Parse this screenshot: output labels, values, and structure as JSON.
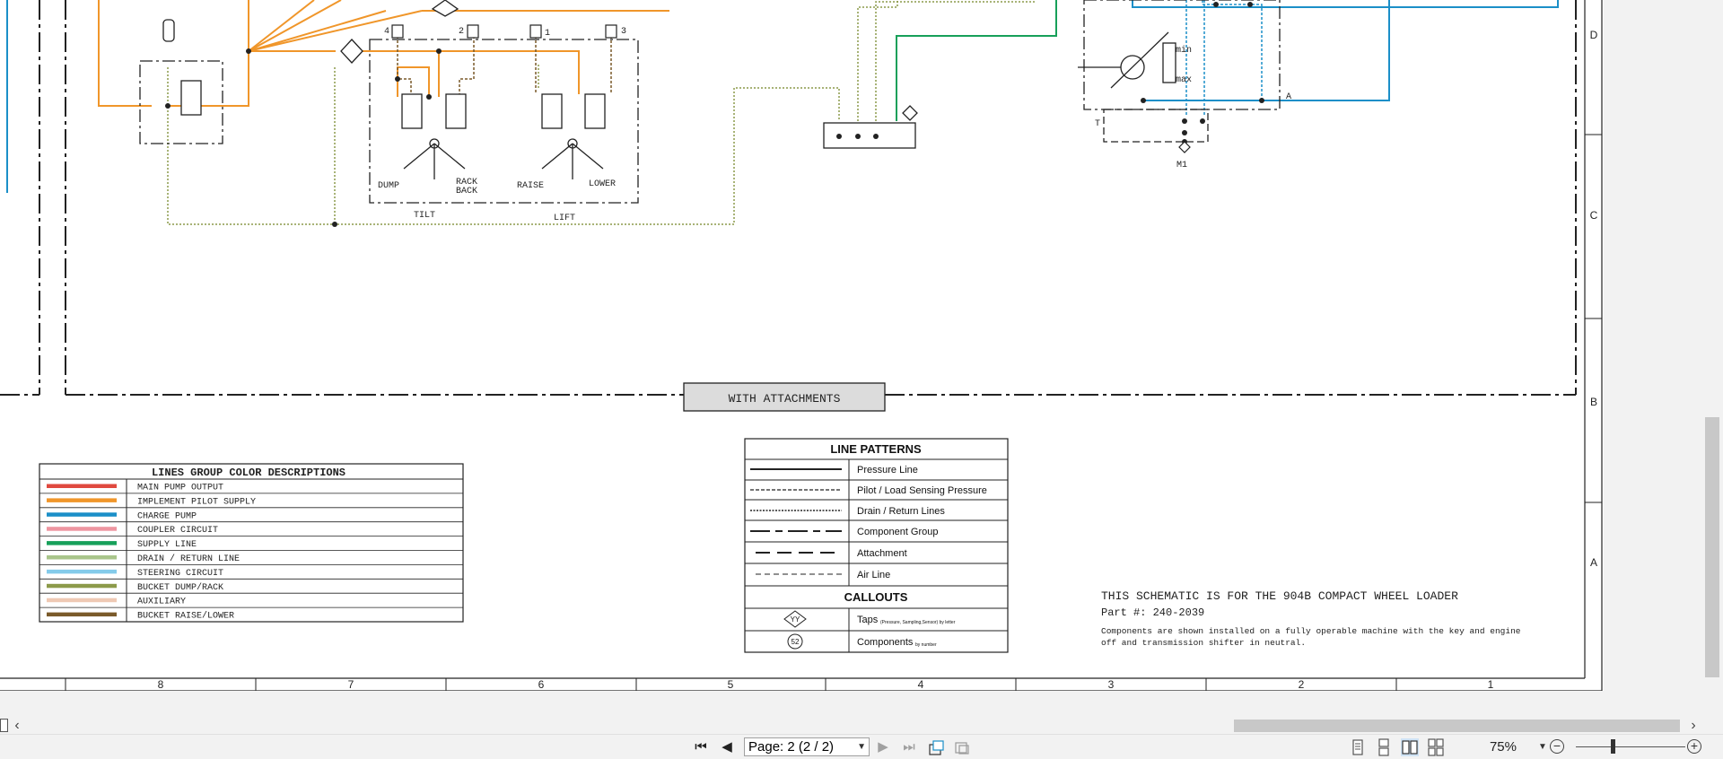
{
  "drawing": {
    "group_labels": {
      "attachments": "WITH ATTACHMENTS"
    },
    "valve_labels": {
      "dump": "DUMP",
      "rack": "RACK",
      "back": "BACK",
      "raise": "RAISE",
      "lower": "LOWER",
      "tilt": "TILT",
      "lift": "LIFT"
    },
    "port_labels": {
      "p4": "4",
      "p2": "2",
      "p1": "1",
      "p3": "3",
      "min": "min",
      "max": "max",
      "a": "A",
      "t": "T",
      "m1": "M1"
    },
    "zone_letters": [
      "D",
      "C",
      "B",
      "A"
    ],
    "zone_numbers": [
      "8",
      "7",
      "6",
      "5",
      "4",
      "3",
      "2",
      "1"
    ]
  },
  "legend": {
    "title": "LINES GROUP COLOR DESCRIPTIONS",
    "items": [
      {
        "label": "MAIN PUMP OUTPUT",
        "color": "#e0493f"
      },
      {
        "label": "IMPLEMENT PILOT SUPPLY",
        "color": "#f0962a"
      },
      {
        "label": "CHARGE PUMP",
        "color": "#1b8fc8"
      },
      {
        "label": "COUPLER CIRCUIT",
        "color": "#ee95a0"
      },
      {
        "label": "SUPPLY LINE",
        "color": "#17a05a"
      },
      {
        "label": "DRAIN / RETURN LINE",
        "color": "#a9c58b"
      },
      {
        "label": "STEERING CIRCUIT",
        "color": "#84cbea"
      },
      {
        "label": "BUCKET DUMP/RACK",
        "color": "#8c9a4a"
      },
      {
        "label": "AUXILIARY",
        "color": "#efc9b4"
      },
      {
        "label": "BUCKET RAISE/LOWER",
        "color": "#7a5a2a"
      }
    ]
  },
  "patterns": {
    "title": "LINE PATTERNS",
    "items": [
      "Pressure Line",
      "Pilot / Load Sensing Pressure",
      "Drain / Return Lines",
      "Component Group",
      "Attachment",
      "Air Line"
    ],
    "callouts_title": "CALLOUTS",
    "taps_symbol": "YY",
    "taps_label": "Taps",
    "taps_note": "(Pressure, Sampling,Sensor) by letter",
    "components_symbol": "52",
    "components_label": "Components",
    "components_note": "by number"
  },
  "info": {
    "title": "THIS SCHEMATIC IS FOR THE 904B COMPACT WHEEL LOADER",
    "part": "Part #: 240-2039",
    "note1": "Components are shown installed on a fully operable machine with the key and engine",
    "note2": "off and transmission shifter in neutral."
  },
  "viewer": {
    "page": "Page: 2 (2 / 2)",
    "zoom": "75%",
    "icons": [
      "first-page-icon",
      "prev-page-icon",
      "next-page-icon",
      "last-page-icon",
      "export-icon",
      "fit-icon",
      "single-page-icon",
      "continuous-icon",
      "two-page-icon",
      "two-page-continuous-icon",
      "zoom-out-icon",
      "zoom-in-icon"
    ]
  }
}
